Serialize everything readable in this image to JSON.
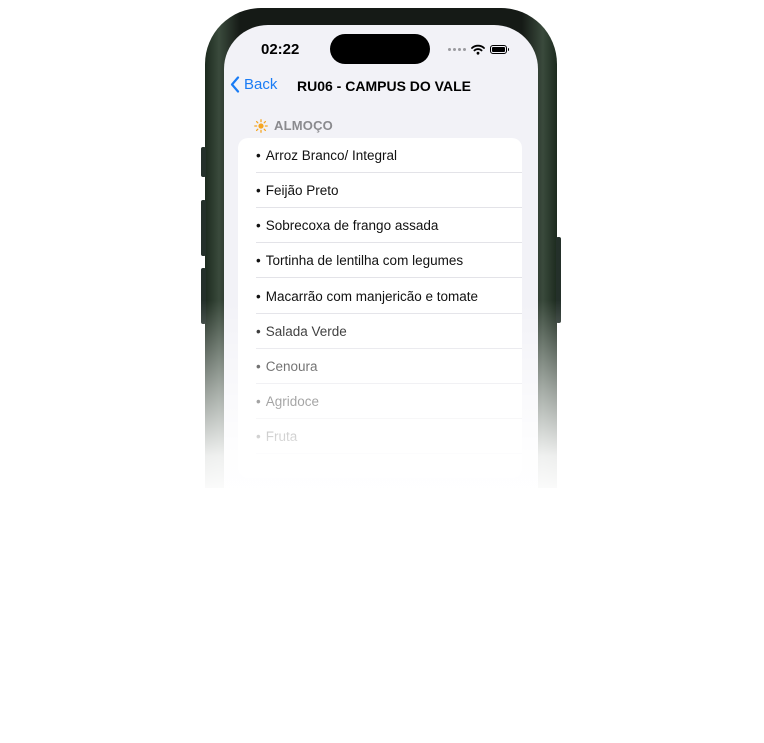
{
  "status_bar": {
    "time": "02:22"
  },
  "nav": {
    "back_label": "Back",
    "title": "RU06 - CAMPUS DO VALE"
  },
  "section": {
    "icon": "sun-icon",
    "icon_color": "#f5a623",
    "label": "ALMOÇO"
  },
  "menu_items": [
    "Arroz Branco/ Integral",
    "Feijão Preto",
    "Sobrecoxa de frango assada",
    "Tortinha de lentilha com legumes",
    "Macarrão com manjericão e tomate",
    "Salada Verde",
    "Cenoura",
    "Agridoce",
    "Fruta"
  ],
  "colors": {
    "accent": "#1a7cf5",
    "background": "#f2f2f7"
  }
}
